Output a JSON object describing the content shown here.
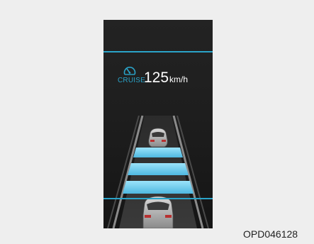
{
  "display": {
    "cruise_icon": "cruise-control-icon",
    "cruise_label": "CRUISE",
    "set_speed": "125",
    "speed_unit": "km/h",
    "front_vehicle_icon": "car-rear-icon",
    "own_vehicle_icon": "car-rear-icon"
  },
  "caption": {
    "figure_code": "OPD046128"
  },
  "colors": {
    "accent": "#2aa3c8",
    "cluster_background": "#1e1e1e",
    "distance_bars": "#7fd4f2",
    "page_background": "#eeeeee"
  }
}
